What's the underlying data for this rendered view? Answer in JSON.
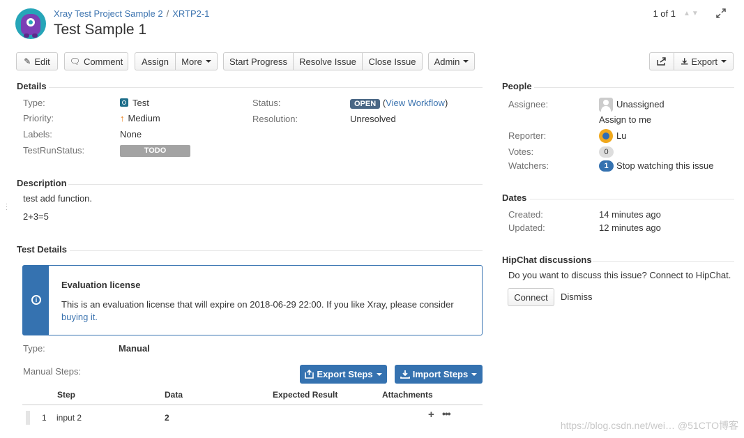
{
  "header": {
    "project": "Xray Test Project Sample 2",
    "separator": "/",
    "issue_key": "XRTP2-1",
    "title": "Test Sample 1",
    "pager": "1 of 1"
  },
  "toolbar": {
    "edit": "Edit",
    "comment": "Comment",
    "assign": "Assign",
    "more": "More",
    "start_progress": "Start Progress",
    "resolve_issue": "Resolve Issue",
    "close_issue": "Close Issue",
    "admin": "Admin",
    "export": "Export"
  },
  "details": {
    "heading": "Details",
    "type_label": "Type:",
    "type_value": "Test",
    "priority_label": "Priority:",
    "priority_value": "Medium",
    "labels_label": "Labels:",
    "labels_value": "None",
    "testrun_label": "TestRunStatus:",
    "testrun_value": "TODO",
    "status_label": "Status:",
    "status_value": "OPEN",
    "view_workflow": "View Workflow",
    "resolution_label": "Resolution:",
    "resolution_value": "Unresolved"
  },
  "description": {
    "heading": "Description",
    "line1": "test add function.",
    "line2": "2+3=5"
  },
  "test_details": {
    "heading": "Test Details",
    "license_title": "Evaluation license",
    "license_text": "This is an evaluation license that will expire on 2018-06-29 22:00. If you like Xray, please consider",
    "license_link": "buying it.",
    "type_label": "Type:",
    "type_value": "Manual",
    "manual_steps_label": "Manual Steps:",
    "export_steps": "Export Steps",
    "import_steps": "Import Steps",
    "columns": [
      "Step",
      "Data",
      "Expected Result",
      "Attachments"
    ],
    "rows": [
      {
        "num": "1",
        "step": "input 2",
        "data": "2",
        "expected": ""
      }
    ]
  },
  "people": {
    "heading": "People",
    "assignee_label": "Assignee:",
    "assignee_value": "Unassigned",
    "assign_to_me": "Assign to me",
    "reporter_label": "Reporter:",
    "reporter_value": "Lu",
    "votes_label": "Votes:",
    "votes_value": "0",
    "watchers_label": "Watchers:",
    "watchers_value": "1",
    "stop_watching": "Stop watching this issue"
  },
  "dates": {
    "heading": "Dates",
    "created_label": "Created:",
    "created_value": "14 minutes ago",
    "updated_label": "Updated:",
    "updated_value": "12 minutes ago"
  },
  "hipchat": {
    "heading": "HipChat discussions",
    "question": "Do you want to discuss this issue? Connect to HipChat.",
    "connect": "Connect",
    "dismiss": "Dismiss"
  },
  "watermark": "https://blog.csdn.net/wei… @51CTO博客",
  "colors": {
    "link": "#3b73af",
    "primary_button": "#3572b0",
    "status_open": "#4a6785",
    "todo": "#a3a3a3"
  }
}
